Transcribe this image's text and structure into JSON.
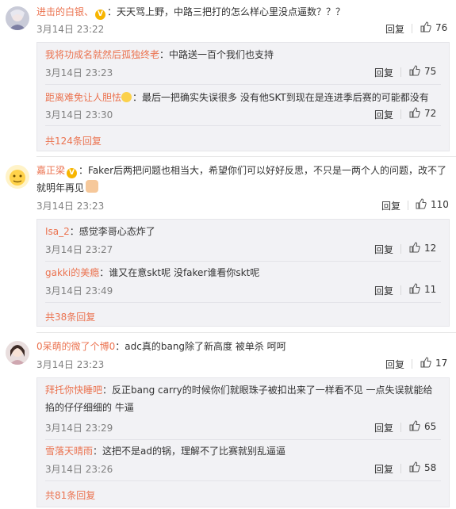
{
  "colors": {
    "username": "#eb7350",
    "text": "#333333",
    "time": "#808080",
    "reply_box_bg": "#f2f2f5"
  },
  "comments": [
    {
      "user": "进击的白银、",
      "badge": "V",
      "text": "：天天骂上野，中路三把打的怎么样心里没点逼数？？？",
      "time": "3月14日 23:22",
      "reply_label": "回复",
      "likes": "76",
      "replies": [
        {
          "user": "我将功成名就然后孤独终老",
          "text": "：中路送一百个我们也支持",
          "time": "3月14日 23:23",
          "reply_label": "回复",
          "likes": "75"
        },
        {
          "user": "距离难免让人胆怯",
          "text": "：最后一把确实失误很多 没有他SKT到现在是连进季后赛的可能都没有",
          "time": "3月14日 23:30",
          "reply_label": "回复",
          "likes": "72"
        }
      ],
      "more": "共124条回复"
    },
    {
      "user": "嘉正梁",
      "badge": "V",
      "text": "：Faker后两把问题也相当大，希望你们可以好好反思，不只是一两个人的问题，改不了就明年再见",
      "time": "3月14日 23:23",
      "reply_label": "回复",
      "likes": "110",
      "replies": [
        {
          "user": "Isa_2",
          "text": "：感觉李哥心态炸了",
          "time": "3月14日 23:27",
          "reply_label": "回复",
          "likes": "12"
        },
        {
          "user": "gakki的美瘾",
          "text": "：谁又在意skt呢 没faker谁看你skt呢",
          "time": "3月14日 23:49",
          "reply_label": "回复",
          "likes": "11"
        }
      ],
      "more": "共38条回复"
    },
    {
      "user": "0呆萌的微了个博0",
      "text": "：adc真的bang除了新高度 被单杀 呵呵",
      "time": "3月14日 23:23",
      "reply_label": "回复",
      "likes": "17",
      "replies": [
        {
          "user": "拜托你快睡吧",
          "text": "：反正bang carry的时候你们就眼珠子被扣出来了一样看不见 一点失误就能给掐的仔仔细细的 牛逼",
          "time": "3月14日 23:29",
          "reply_label": "回复",
          "likes": "65"
        },
        {
          "user": "雪落天晴雨",
          "text": "：这把不是ad的锅，理解不了比赛就别乱逼逼",
          "time": "3月14日 23:26",
          "reply_label": "回复",
          "likes": "58"
        }
      ],
      "more": "共81条回复"
    }
  ]
}
